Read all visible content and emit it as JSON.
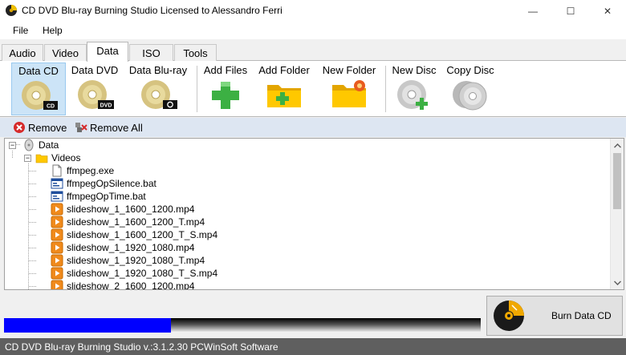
{
  "window": {
    "title": "CD DVD Blu-ray Burning Studio Licensed to Alessandro Ferri",
    "controls": {
      "minimize": "—",
      "maximize": "☐",
      "close": "✕"
    }
  },
  "menu": [
    "File",
    "Help"
  ],
  "tabs": [
    {
      "label": "Audio",
      "active": false
    },
    {
      "label": "Video",
      "active": false
    },
    {
      "label": "Data",
      "active": true
    },
    {
      "label": "ISO",
      "active": false
    },
    {
      "label": "Tools",
      "active": false
    }
  ],
  "ribbon": {
    "data_cd": {
      "label": "Data CD",
      "badge": "CD",
      "selected": true
    },
    "data_dvd": {
      "label": "Data DVD",
      "badge": "DVD"
    },
    "data_bluray": {
      "label": "Data Blu-ray",
      "icon": "blu-ray-logo-icon"
    },
    "add_files": {
      "label": "Add Files",
      "icon": "plus-icon"
    },
    "add_folder": {
      "label": "Add Folder",
      "icon": "folder-add-icon"
    },
    "new_folder": {
      "label": "New Folder",
      "icon": "folder-new-icon"
    },
    "new_disc": {
      "label": "New Disc",
      "icon": "disc-add-icon"
    },
    "copy_disc": {
      "label": "Copy Disc",
      "icon": "disc-copy-icon"
    }
  },
  "actions": {
    "remove": "Remove",
    "remove_all": "Remove All"
  },
  "tree": {
    "root": {
      "label": "Data",
      "expander": "−"
    },
    "folder": {
      "label": "Videos",
      "expander": "−"
    },
    "files": [
      {
        "name": "ffmpeg.exe",
        "type": "exe"
      },
      {
        "name": "ffmpegOpSilence.bat",
        "type": "bat"
      },
      {
        "name": "ffmpegOpTime.bat",
        "type": "bat"
      },
      {
        "name": "slideshow_1_1600_1200.mp4",
        "type": "mp4"
      },
      {
        "name": "slideshow_1_1600_1200_T.mp4",
        "type": "mp4"
      },
      {
        "name": "slideshow_1_1600_1200_T_S.mp4",
        "type": "mp4"
      },
      {
        "name": "slideshow_1_1920_1080.mp4",
        "type": "mp4"
      },
      {
        "name": "slideshow_1_1920_1080_T.mp4",
        "type": "mp4"
      },
      {
        "name": "slideshow_1_1920_1080_T_S.mp4",
        "type": "mp4"
      },
      {
        "name": "slideshow_2_1600_1200.mp4",
        "type": "mp4"
      }
    ]
  },
  "progress": {
    "fraction": 0.35,
    "color": "#0000ff"
  },
  "burn_button": {
    "label": "Burn Data CD"
  },
  "status": "CD DVD Blu-ray Burning Studio v.:3.1.2.30 PCWinSoft Software"
}
